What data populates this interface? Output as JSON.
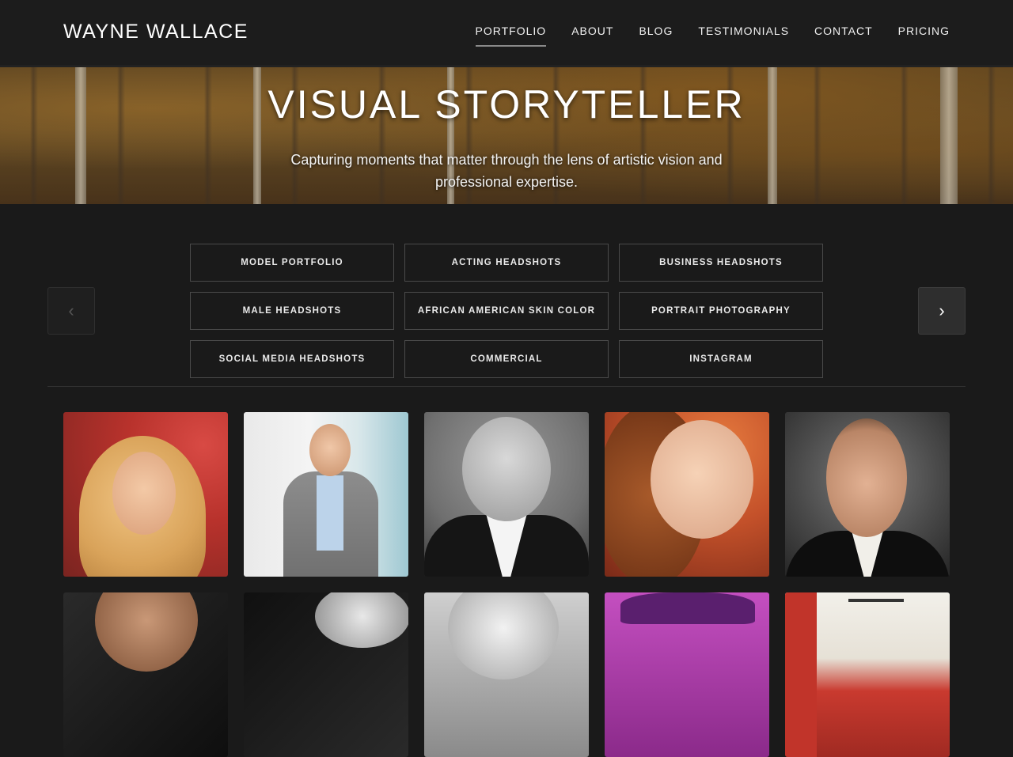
{
  "brand": "WAYNE WALLACE",
  "nav": [
    {
      "label": "PORTFOLIO",
      "active": true
    },
    {
      "label": "ABOUT",
      "active": false
    },
    {
      "label": "BLOG",
      "active": false
    },
    {
      "label": "TESTIMONIALS",
      "active": false
    },
    {
      "label": "CONTACT",
      "active": false
    },
    {
      "label": "PRICING",
      "active": false
    }
  ],
  "hero": {
    "title": "VISUAL STORYTELLER",
    "subtitle": "Capturing moments that matter through the lens of artistic vision and professional expertise."
  },
  "categories": {
    "prev_icon": "chevron-left-icon",
    "next_icon": "chevron-right-icon",
    "prev_symbol": "‹",
    "next_symbol": "›",
    "items": [
      "MODEL PORTFOLIO",
      "ACTING HEADSHOTS",
      "BUSINESS HEADSHOTS",
      "MALE HEADSHOTS",
      "AFRICAN AMERICAN SKIN COLOR",
      "PORTRAIT PHOTOGRAPHY",
      "SOCIAL MEDIA HEADSHOTS",
      "COMMERCIAL",
      "INSTAGRAM"
    ]
  },
  "gallery": {
    "photos": [
      "blonde-woman-portrait",
      "man-in-gray-suit",
      "smiling-bald-man-bw",
      "redhead-woman-closeup",
      "mustached-man-in-suit",
      "man-portrait-dark",
      "woman-portrait-bw",
      "gray-haired-man",
      "woman-purple-hat",
      "interior-room-red-wall"
    ]
  },
  "colors": {
    "background": "#1a1a1a",
    "header": "#1c1c1c",
    "accent_underline": "#8a8a8a",
    "button_border": "#4a4a4a"
  }
}
